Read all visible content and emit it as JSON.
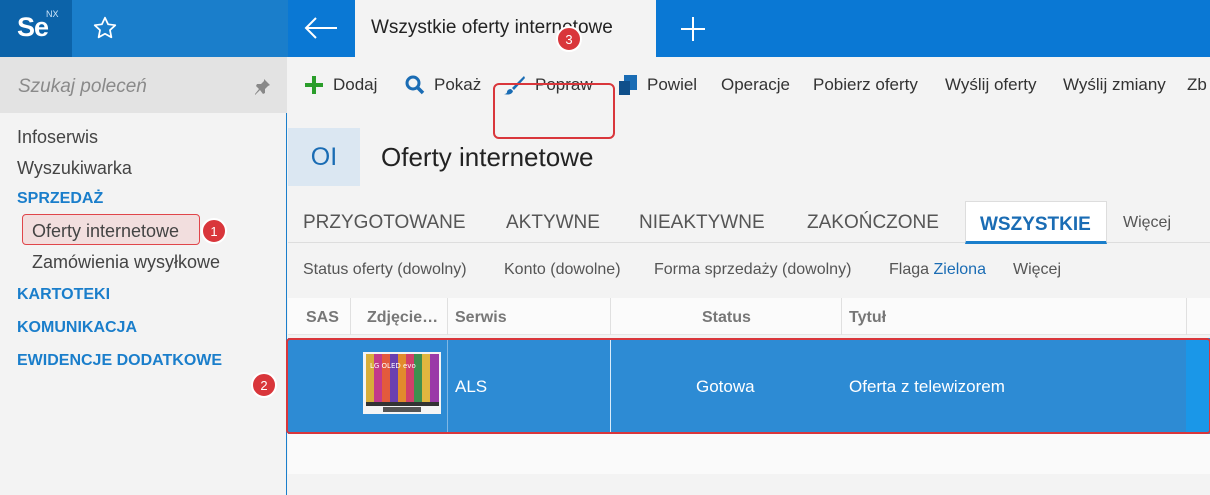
{
  "app": {
    "logo_text": "Se",
    "logo_suffix": "NX"
  },
  "window": {
    "active_tab": "Wszystkie oferty internetowe"
  },
  "sidebar": {
    "search_placeholder": "Szukaj poleceń",
    "items": [
      {
        "label": "Infoserwis",
        "type": "item"
      },
      {
        "label": "Wyszukiwarka",
        "type": "item"
      },
      {
        "label": "SPRZEDAŻ",
        "type": "section"
      },
      {
        "label": "Oferty internetowe",
        "type": "subitem"
      },
      {
        "label": "Zamówienia wysyłkowe",
        "type": "subitem"
      },
      {
        "label": "KARTOTEKI",
        "type": "section"
      },
      {
        "label": "KOMUNIKACJA",
        "type": "section"
      },
      {
        "label": "EWIDENCJE DODATKOWE",
        "type": "section"
      }
    ]
  },
  "toolbar": {
    "items": [
      "Dodaj",
      "Pokaż",
      "Popraw",
      "Powiel",
      "Operacje",
      "Pobierz oferty",
      "Wyślij oferty",
      "Wyślij zmiany",
      "Zb"
    ]
  },
  "header": {
    "badge": "OI",
    "title": "Oferty internetowe"
  },
  "tabs": [
    "PRZYGOTOWANE",
    "AKTYWNE",
    "NIEAKTYWNE",
    "ZAKOŃCZONE",
    "WSZYSTKIE",
    "Więcej"
  ],
  "filters": {
    "status": "Status oferty (dowolny)",
    "account": "Konto (dowolne)",
    "sale_form": "Forma sprzedaży (dowolny)",
    "flag_label": "Flaga",
    "flag_value": "Zielona",
    "more": "Więcej"
  },
  "grid": {
    "columns": [
      "SAS",
      "Zdjęcie…",
      "Serwis",
      "Status",
      "Tytuł"
    ],
    "rows": [
      {
        "serwis": "ALS",
        "status": "Gotowa",
        "tytul": "Oferta z telewizorem",
        "thumb_text": "LG OLED evo"
      }
    ]
  },
  "callouts": [
    "1",
    "2",
    "3"
  ],
  "colors": {
    "accent": "#1a7ecb",
    "selected_row": "#2d8bd4",
    "highlight": "#d9363b",
    "add_green": "#2a9d2a"
  }
}
